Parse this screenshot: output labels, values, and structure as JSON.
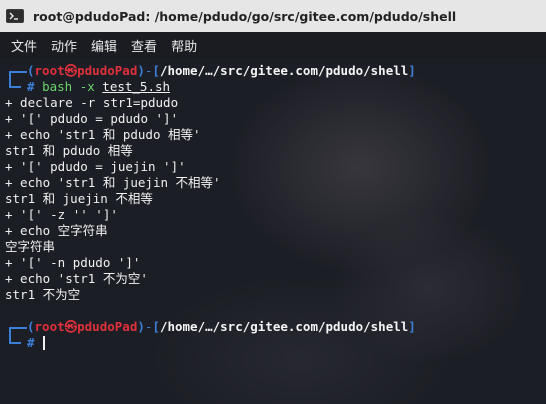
{
  "window": {
    "title": "root@pdudoPad: /home/pdudo/go/src/gitee.com/pdudo/shell"
  },
  "menu": {
    "items": [
      {
        "label": "文件"
      },
      {
        "label": "动作"
      },
      {
        "label": "编辑"
      },
      {
        "label": "查看"
      },
      {
        "label": "帮助"
      }
    ]
  },
  "prompt": {
    "open_paren": "(",
    "userhost": "root㉿pdudoPad",
    "close_paren": ")",
    "dash": "-",
    "open_bracket": "[",
    "path": "/home/…/src/gitee.com/pdudo/shell",
    "close_bracket": "]",
    "hash": "#"
  },
  "command": {
    "name": "bash",
    "flag": "-x",
    "file": "test_5.sh"
  },
  "output": [
    "+ declare -r str1=pdudo",
    "+ '[' pdudo = pdudo ']'",
    "+ echo 'str1 和 pdudo 相等'",
    "str1 和 pdudo 相等",
    "+ '[' pdudo = juejin ']'",
    "+ echo 'str1 和 juejin 不相等'",
    "str1 和 juejin 不相等",
    "+ '[' -z '' ']'",
    "+ echo 空字符串",
    "空字符串",
    "+ '[' -n pdudo ']'",
    "+ echo 'str1 不为空'",
    "str1 不为空"
  ],
  "colors": {
    "prompt_blue": "#3d7fd8",
    "prompt_red": "#e0303c",
    "command_green": "#6bd36b",
    "terminal_bg": "#1c1e25"
  }
}
